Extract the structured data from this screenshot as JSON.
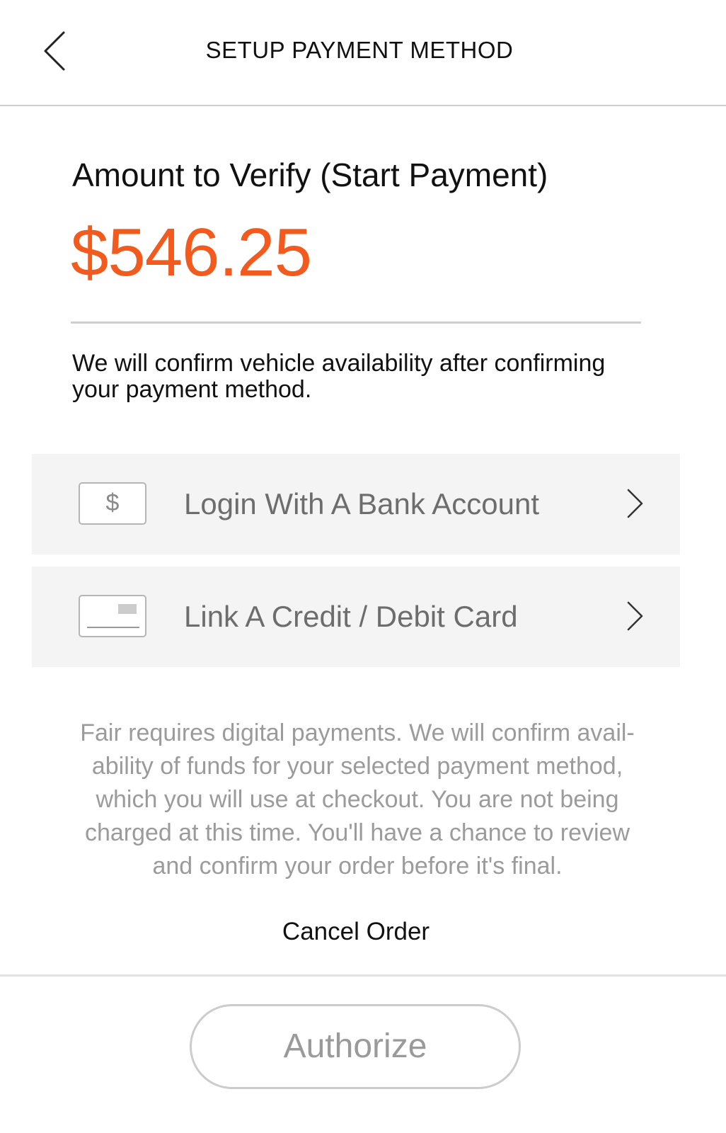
{
  "header": {
    "title": "SETUP PAYMENT METHOD",
    "back_icon": "chevron-left-icon"
  },
  "amount": {
    "label": "Amount to Verify (Start Payment)",
    "value": "$546.25",
    "color": "#f25a1e"
  },
  "confirm_message": "We will confirm vehicle availability after confirming your payment method.",
  "options": [
    {
      "label": "Login With A Bank Account",
      "icon": "bank-dollar-icon",
      "icon_glyph": "$"
    },
    {
      "label": "Link A Credit / Debit Card",
      "icon": "credit-card-icon"
    }
  ],
  "disclaimer": "Fair requires digital payments. We will confirm avail-ability of funds for your selected payment method, which you will use at checkout. You are not being charged at this time. You'll have a chance to review and confirm your order before it's final.",
  "cancel_label": "Cancel Order",
  "authorize_label": "Authorize"
}
